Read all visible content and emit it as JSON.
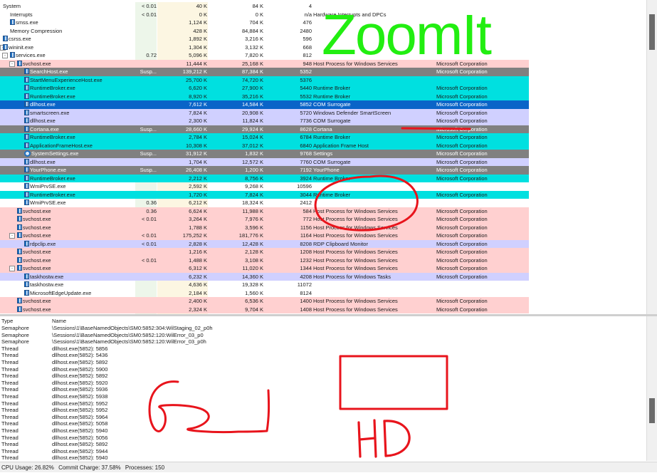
{
  "processes": [
    {
      "name": "System",
      "indent": 0,
      "toggle": "",
      "icon": "none",
      "cpu": "< 0.01",
      "private": "40 K",
      "working": "84 K",
      "pid": "4",
      "desc": "",
      "company": "",
      "bg": ""
    },
    {
      "name": "Interrupts",
      "indent": 1,
      "toggle": "",
      "icon": "none",
      "cpu": "< 0.01",
      "private": "0 K",
      "working": "0 K",
      "pid": "n/a",
      "desc": "Hardware Interrupts and DPCs",
      "company": "",
      "bg": ""
    },
    {
      "name": "smss.exe",
      "indent": 1,
      "toggle": "",
      "icon": "pin",
      "cpu": "",
      "private": "1,124 K",
      "working": "704 K",
      "pid": "476",
      "desc": "",
      "company": "",
      "bg": ""
    },
    {
      "name": "Memory Compression",
      "indent": 1,
      "toggle": "",
      "icon": "none",
      "cpu": "",
      "private": "428 K",
      "working": "84,884 K",
      "pid": "2480",
      "desc": "",
      "company": "",
      "bg": ""
    },
    {
      "name": "csrss.exe",
      "indent": 0,
      "toggle": "",
      "icon": "pin",
      "cpu": "",
      "private": "1,892 K",
      "working": "3,216 K",
      "pid": "596",
      "desc": "",
      "company": "",
      "bg": ""
    },
    {
      "name": "wininit.exe",
      "indent": 0,
      "toggle": "-",
      "icon": "pin",
      "cpu": "",
      "private": "1,304 K",
      "working": "3,132 K",
      "pid": "668",
      "desc": "",
      "company": "",
      "bg": ""
    },
    {
      "name": "services.exe",
      "indent": 1,
      "toggle": "-",
      "icon": "pin",
      "cpu": "0.72",
      "private": "5,096 K",
      "working": "7,820 K",
      "pid": "812",
      "desc": "",
      "company": "",
      "bg": ""
    },
    {
      "name": "svchost.exe",
      "indent": 2,
      "toggle": "-",
      "icon": "pin",
      "cpu": "",
      "private": "11,444 K",
      "working": "25,168 K",
      "pid": "948",
      "desc": "Host Process for Windows Services",
      "company": "Microsoft Corporation",
      "bg": "#ffd0d0"
    },
    {
      "name": "SearchHost.exe",
      "indent": 3,
      "toggle": "",
      "icon": "pin",
      "cpu": "Susp...",
      "private": "139,212 K",
      "working": "87,384 K",
      "pid": "5352",
      "desc": "",
      "company": "Microsoft Corporation",
      "bg": "#808080"
    },
    {
      "name": "StartMenuExperienceHost.exe",
      "indent": 3,
      "toggle": "",
      "icon": "pin",
      "cpu": "",
      "private": "25,700 K",
      "working": "74,720 K",
      "pid": "5376",
      "desc": "",
      "company": "",
      "bg": "#00e0e0"
    },
    {
      "name": "RuntimeBroker.exe",
      "indent": 3,
      "toggle": "",
      "icon": "pin",
      "cpu": "",
      "private": "6,620 K",
      "working": "27,900 K",
      "pid": "5440",
      "desc": "Runtime Broker",
      "company": "Microsoft Corporation",
      "bg": "#00e0e0"
    },
    {
      "name": "RuntimeBroker.exe",
      "indent": 3,
      "toggle": "",
      "icon": "pin",
      "cpu": "",
      "private": "8,920 K",
      "working": "35,216 K",
      "pid": "5532",
      "desc": "Runtime Broker",
      "company": "Microsoft Corporation",
      "bg": "#00e0e0"
    },
    {
      "name": "dllhost.exe",
      "indent": 3,
      "toggle": "",
      "icon": "pin",
      "cpu": "",
      "private": "7,612 K",
      "working": "14,584 K",
      "pid": "5852",
      "desc": "COM Surrogate",
      "company": "Microsoft Corporation",
      "bg": "#0a64c8",
      "sel": true
    },
    {
      "name": "smartscreen.exe",
      "indent": 3,
      "toggle": "",
      "icon": "pin",
      "cpu": "",
      "private": "7,824 K",
      "working": "20,908 K",
      "pid": "5720",
      "desc": "Windows Defender SmartScreen",
      "company": "Microsoft Corporation",
      "bg": "#d0d0ff"
    },
    {
      "name": "dllhost.exe",
      "indent": 3,
      "toggle": "",
      "icon": "pin",
      "cpu": "",
      "private": "2,300 K",
      "working": "11,824 K",
      "pid": "7736",
      "desc": "COM Surrogate",
      "company": "Microsoft Corporation",
      "bg": "#d0d0ff"
    },
    {
      "name": "Cortana.exe",
      "indent": 3,
      "toggle": "",
      "icon": "pin",
      "cpu": "Susp...",
      "private": "28,660 K",
      "working": "29,924 K",
      "pid": "8628",
      "desc": "Cortana",
      "company": "Microsoft Corporation",
      "bg": "#808080"
    },
    {
      "name": "RuntimeBroker.exe",
      "indent": 3,
      "toggle": "",
      "icon": "pin",
      "cpu": "",
      "private": "2,784 K",
      "working": "15,024 K",
      "pid": "6784",
      "desc": "Runtime Broker",
      "company": "Microsoft Corporation",
      "bg": "#00e0e0"
    },
    {
      "name": "ApplicationFrameHost.exe",
      "indent": 3,
      "toggle": "",
      "icon": "pin",
      "cpu": "",
      "private": "10,308 K",
      "working": "37,012 K",
      "pid": "6840",
      "desc": "Application Frame Host",
      "company": "Microsoft Corporation",
      "bg": "#00e0e0"
    },
    {
      "name": "SystemSettings.exe",
      "indent": 3,
      "toggle": "",
      "icon": "gear",
      "cpu": "Susp...",
      "private": "31,912 K",
      "working": "1,832 K",
      "pid": "9768",
      "desc": "Settings",
      "company": "Microsoft Corporation",
      "bg": "#808080"
    },
    {
      "name": "dllhost.exe",
      "indent": 3,
      "toggle": "",
      "icon": "pin",
      "cpu": "",
      "private": "1,704 K",
      "working": "12,572 K",
      "pid": "7760",
      "desc": "COM Surrogate",
      "company": "Microsoft Corporation",
      "bg": "#d0d0ff"
    },
    {
      "name": "YourPhone.exe",
      "indent": 3,
      "toggle": "",
      "icon": "pin",
      "cpu": "Susp...",
      "private": "26,408 K",
      "working": "1,200 K",
      "pid": "7192",
      "desc": "YourPhone",
      "company": "Microsoft Corporation",
      "bg": "#808080"
    },
    {
      "name": "RuntimeBroker.exe",
      "indent": 3,
      "toggle": "",
      "icon": "pin",
      "cpu": "",
      "private": "2,212 K",
      "working": "8,756 K",
      "pid": "3924",
      "desc": "Runtime Broker",
      "company": "Microsoft Corporation",
      "bg": "#00e0e0"
    },
    {
      "name": "WmiPrvSE.exe",
      "indent": 3,
      "toggle": "",
      "icon": "pin",
      "cpu": "",
      "private": "2,592 K",
      "working": "9,268 K",
      "pid": "10596",
      "desc": "",
      "company": "",
      "bg": ""
    },
    {
      "name": "RuntimeBroker.exe",
      "indent": 3,
      "toggle": "",
      "icon": "pin",
      "cpu": "",
      "private": "1,720 K",
      "working": "7,824 K",
      "pid": "3044",
      "desc": "Runtime Broker",
      "company": "Microsoft Corporation",
      "bg": "#00e0e0"
    },
    {
      "name": "WmiPrvSE.exe",
      "indent": 3,
      "toggle": "",
      "icon": "pin",
      "cpu": "0.36",
      "private": "6,212 K",
      "working": "18,324 K",
      "pid": "2412",
      "desc": "",
      "company": "",
      "bg": ""
    },
    {
      "name": "svchost.exe",
      "indent": 2,
      "toggle": "",
      "icon": "pin",
      "cpu": "0.36",
      "private": "6,624 K",
      "working": "11,988 K",
      "pid": "584",
      "desc": "Host Process for Windows Services",
      "company": "Microsoft Corporation",
      "bg": "#ffd0d0"
    },
    {
      "name": "svchost.exe",
      "indent": 2,
      "toggle": "",
      "icon": "pin",
      "cpu": "< 0.01",
      "private": "3,264 K",
      "working": "7,976 K",
      "pid": "772",
      "desc": "Host Process for Windows Services",
      "company": "Microsoft Corporation",
      "bg": "#ffd0d0"
    },
    {
      "name": "svchost.exe",
      "indent": 2,
      "toggle": "",
      "icon": "pin",
      "cpu": "",
      "private": "1,788 K",
      "working": "3,596 K",
      "pid": "1156",
      "desc": "Host Process for Windows Services",
      "company": "Microsoft Corporation",
      "bg": "#ffd0d0"
    },
    {
      "name": "svchost.exe",
      "indent": 2,
      "toggle": "-",
      "icon": "pin",
      "cpu": "< 0.01",
      "private": "175,252 K",
      "working": "181,776 K",
      "pid": "1164",
      "desc": "Host Process for Windows Services",
      "company": "Microsoft Corporation",
      "bg": "#ffd0d0"
    },
    {
      "name": "rdpclip.exe",
      "indent": 3,
      "toggle": "",
      "icon": "pin",
      "cpu": "< 0.01",
      "private": "2,828 K",
      "working": "12,428 K",
      "pid": "8208",
      "desc": "RDP Clipboard Monitor",
      "company": "Microsoft Corporation",
      "bg": "#d0d0ff"
    },
    {
      "name": "svchost.exe",
      "indent": 2,
      "toggle": "",
      "icon": "pin",
      "cpu": "",
      "private": "1,216 K",
      "working": "2,128 K",
      "pid": "1208",
      "desc": "Host Process for Windows Services",
      "company": "Microsoft Corporation",
      "bg": "#ffd0d0"
    },
    {
      "name": "svchost.exe",
      "indent": 2,
      "toggle": "",
      "icon": "pin",
      "cpu": "< 0.01",
      "private": "1,488 K",
      "working": "3,108 K",
      "pid": "1232",
      "desc": "Host Process for Windows Services",
      "company": "Microsoft Corporation",
      "bg": "#ffd0d0"
    },
    {
      "name": "svchost.exe",
      "indent": 2,
      "toggle": "-",
      "icon": "pin",
      "cpu": "",
      "private": "6,312 K",
      "working": "11,020 K",
      "pid": "1344",
      "desc": "Host Process for Windows Services",
      "company": "Microsoft Corporation",
      "bg": "#ffd0d0"
    },
    {
      "name": "taskhostw.exe",
      "indent": 3,
      "toggle": "",
      "icon": "pin",
      "cpu": "",
      "private": "6,232 K",
      "working": "14,360 K",
      "pid": "4208",
      "desc": "Host Process for Windows Tasks",
      "company": "Microsoft Corporation",
      "bg": "#d0d0ff"
    },
    {
      "name": "taskhostw.exe",
      "indent": 3,
      "toggle": "",
      "icon": "pin",
      "cpu": "",
      "private": "4,636 K",
      "working": "19,328 K",
      "pid": "11072",
      "desc": "",
      "company": "",
      "bg": ""
    },
    {
      "name": "MicrosoftEdgeUpdate.exe",
      "indent": 3,
      "toggle": "",
      "icon": "pin",
      "cpu": "",
      "private": "2,184 K",
      "working": "1,560 K",
      "pid": "8124",
      "desc": "",
      "company": "",
      "bg": ""
    },
    {
      "name": "svchost.exe",
      "indent": 2,
      "toggle": "",
      "icon": "pin",
      "cpu": "",
      "private": "2,400 K",
      "working": "6,536 K",
      "pid": "1400",
      "desc": "Host Process for Windows Services",
      "company": "Microsoft Corporation",
      "bg": "#ffd0d0"
    },
    {
      "name": "svchost.exe",
      "indent": 2,
      "toggle": "",
      "icon": "pin",
      "cpu": "",
      "private": "2,324 K",
      "working": "9,704 K",
      "pid": "1408",
      "desc": "Host Process for Windows Services",
      "company": "Microsoft Corporation",
      "bg": "#ffd0d0"
    }
  ],
  "handles": {
    "header": {
      "type": "Type",
      "name": "Name"
    },
    "rows": [
      {
        "type": "Semaphore",
        "name": "\\Sessions\\1\\BaseNamedObjects\\SM0:5852:304:WilStaging_02_p0h"
      },
      {
        "type": "Semaphore",
        "name": "\\Sessions\\1\\BaseNamedObjects\\SM0:5852:120:WilError_03_p0"
      },
      {
        "type": "Semaphore",
        "name": "\\Sessions\\1\\BaseNamedObjects\\SM0:5852:120:WilError_03_p0h"
      },
      {
        "type": "Thread",
        "name": "dllhost.exe(5852): 5856"
      },
      {
        "type": "Thread",
        "name": "dllhost.exe(5852): 5436"
      },
      {
        "type": "Thread",
        "name": "dllhost.exe(5852): 5892"
      },
      {
        "type": "Thread",
        "name": "dllhost.exe(5852): 5900"
      },
      {
        "type": "Thread",
        "name": "dllhost.exe(5852): 5892"
      },
      {
        "type": "Thread",
        "name": "dllhost.exe(5852): 5920"
      },
      {
        "type": "Thread",
        "name": "dllhost.exe(5852): 5936"
      },
      {
        "type": "Thread",
        "name": "dllhost.exe(5852): 5938"
      },
      {
        "type": "Thread",
        "name": "dllhost.exe(5852): 5952"
      },
      {
        "type": "Thread",
        "name": "dllhost.exe(5852): 5952"
      },
      {
        "type": "Thread",
        "name": "dllhost.exe(5852): 5964"
      },
      {
        "type": "Thread",
        "name": "dllhost.exe(5852): 5058"
      },
      {
        "type": "Thread",
        "name": "dllhost.exe(5852): 5940"
      },
      {
        "type": "Thread",
        "name": "dllhost.exe(5852): 5056"
      },
      {
        "type": "Thread",
        "name": "dllhost.exe(5852): 5892"
      },
      {
        "type": "Thread",
        "name": "dllhost.exe(5852): 5944"
      },
      {
        "type": "Thread",
        "name": "dllhost.exe(5852): 5940"
      }
    ]
  },
  "status": {
    "cpu": "CPU Usage: 26.82%",
    "commit": "Commit Charge: 37.58%",
    "processes": "Processes: 150"
  },
  "annotations": {
    "zoomit_text": "ZoomIt",
    "hd_text": "HD",
    "zoomit_color": "#22ee11",
    "ink_color": "#e8141c"
  }
}
